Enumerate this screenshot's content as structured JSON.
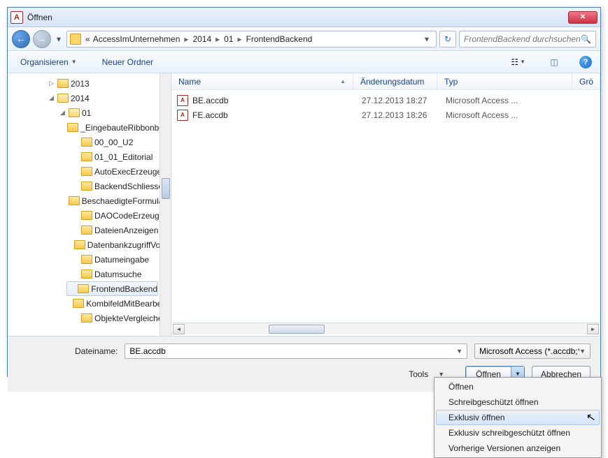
{
  "title": "Öffnen",
  "breadcrumb": {
    "chevrons": "«",
    "items": [
      "AccessImUnternehmen",
      "2014",
      "01",
      "FrontendBackend"
    ]
  },
  "search": {
    "placeholder": "FrontendBackend durchsuchen"
  },
  "toolbar": {
    "organize": "Organisieren",
    "newfolder": "Neuer Ordner"
  },
  "tree": {
    "y2013": "2013",
    "y2014": "2014",
    "m01": "01",
    "items": [
      "_EingebauteRibbonbefe",
      "00_00_U2",
      "01_01_Editorial",
      "AutoExecErzeugen",
      "BackendSchliessen",
      "BeschaedigteFormulare",
      "DAOCodeErzeugen",
      "DateienAnzeigen",
      "DatenbankzugriffVonA",
      "Datumeingabe",
      "Datumsuche",
      "FrontendBackend",
      "KombifeldMitBearbeitu",
      "ObjekteVergleichen"
    ]
  },
  "columns": {
    "name": "Name",
    "date": "Änderungsdatum",
    "type": "Typ",
    "size": "Grö"
  },
  "files": [
    {
      "name": "BE.accdb",
      "date": "27.12.2013 18:27",
      "type": "Microsoft Access ..."
    },
    {
      "name": "FE.accdb",
      "date": "27.12.2013 18:26",
      "type": "Microsoft Access ..."
    }
  ],
  "footer": {
    "filename_label": "Dateiname:",
    "filename_value": "BE.accdb",
    "filter": "Microsoft Access (*.accdb;*.mc",
    "tools": "Tools",
    "open": "Öffnen",
    "cancel": "Abbrechen"
  },
  "menu": {
    "items": [
      "Öffnen",
      "Schreibgeschützt öffnen",
      "Exklusiv öffnen",
      "Exklusiv schreibgeschützt öffnen",
      "Vorherige Versionen anzeigen"
    ],
    "hoverIndex": 2
  }
}
